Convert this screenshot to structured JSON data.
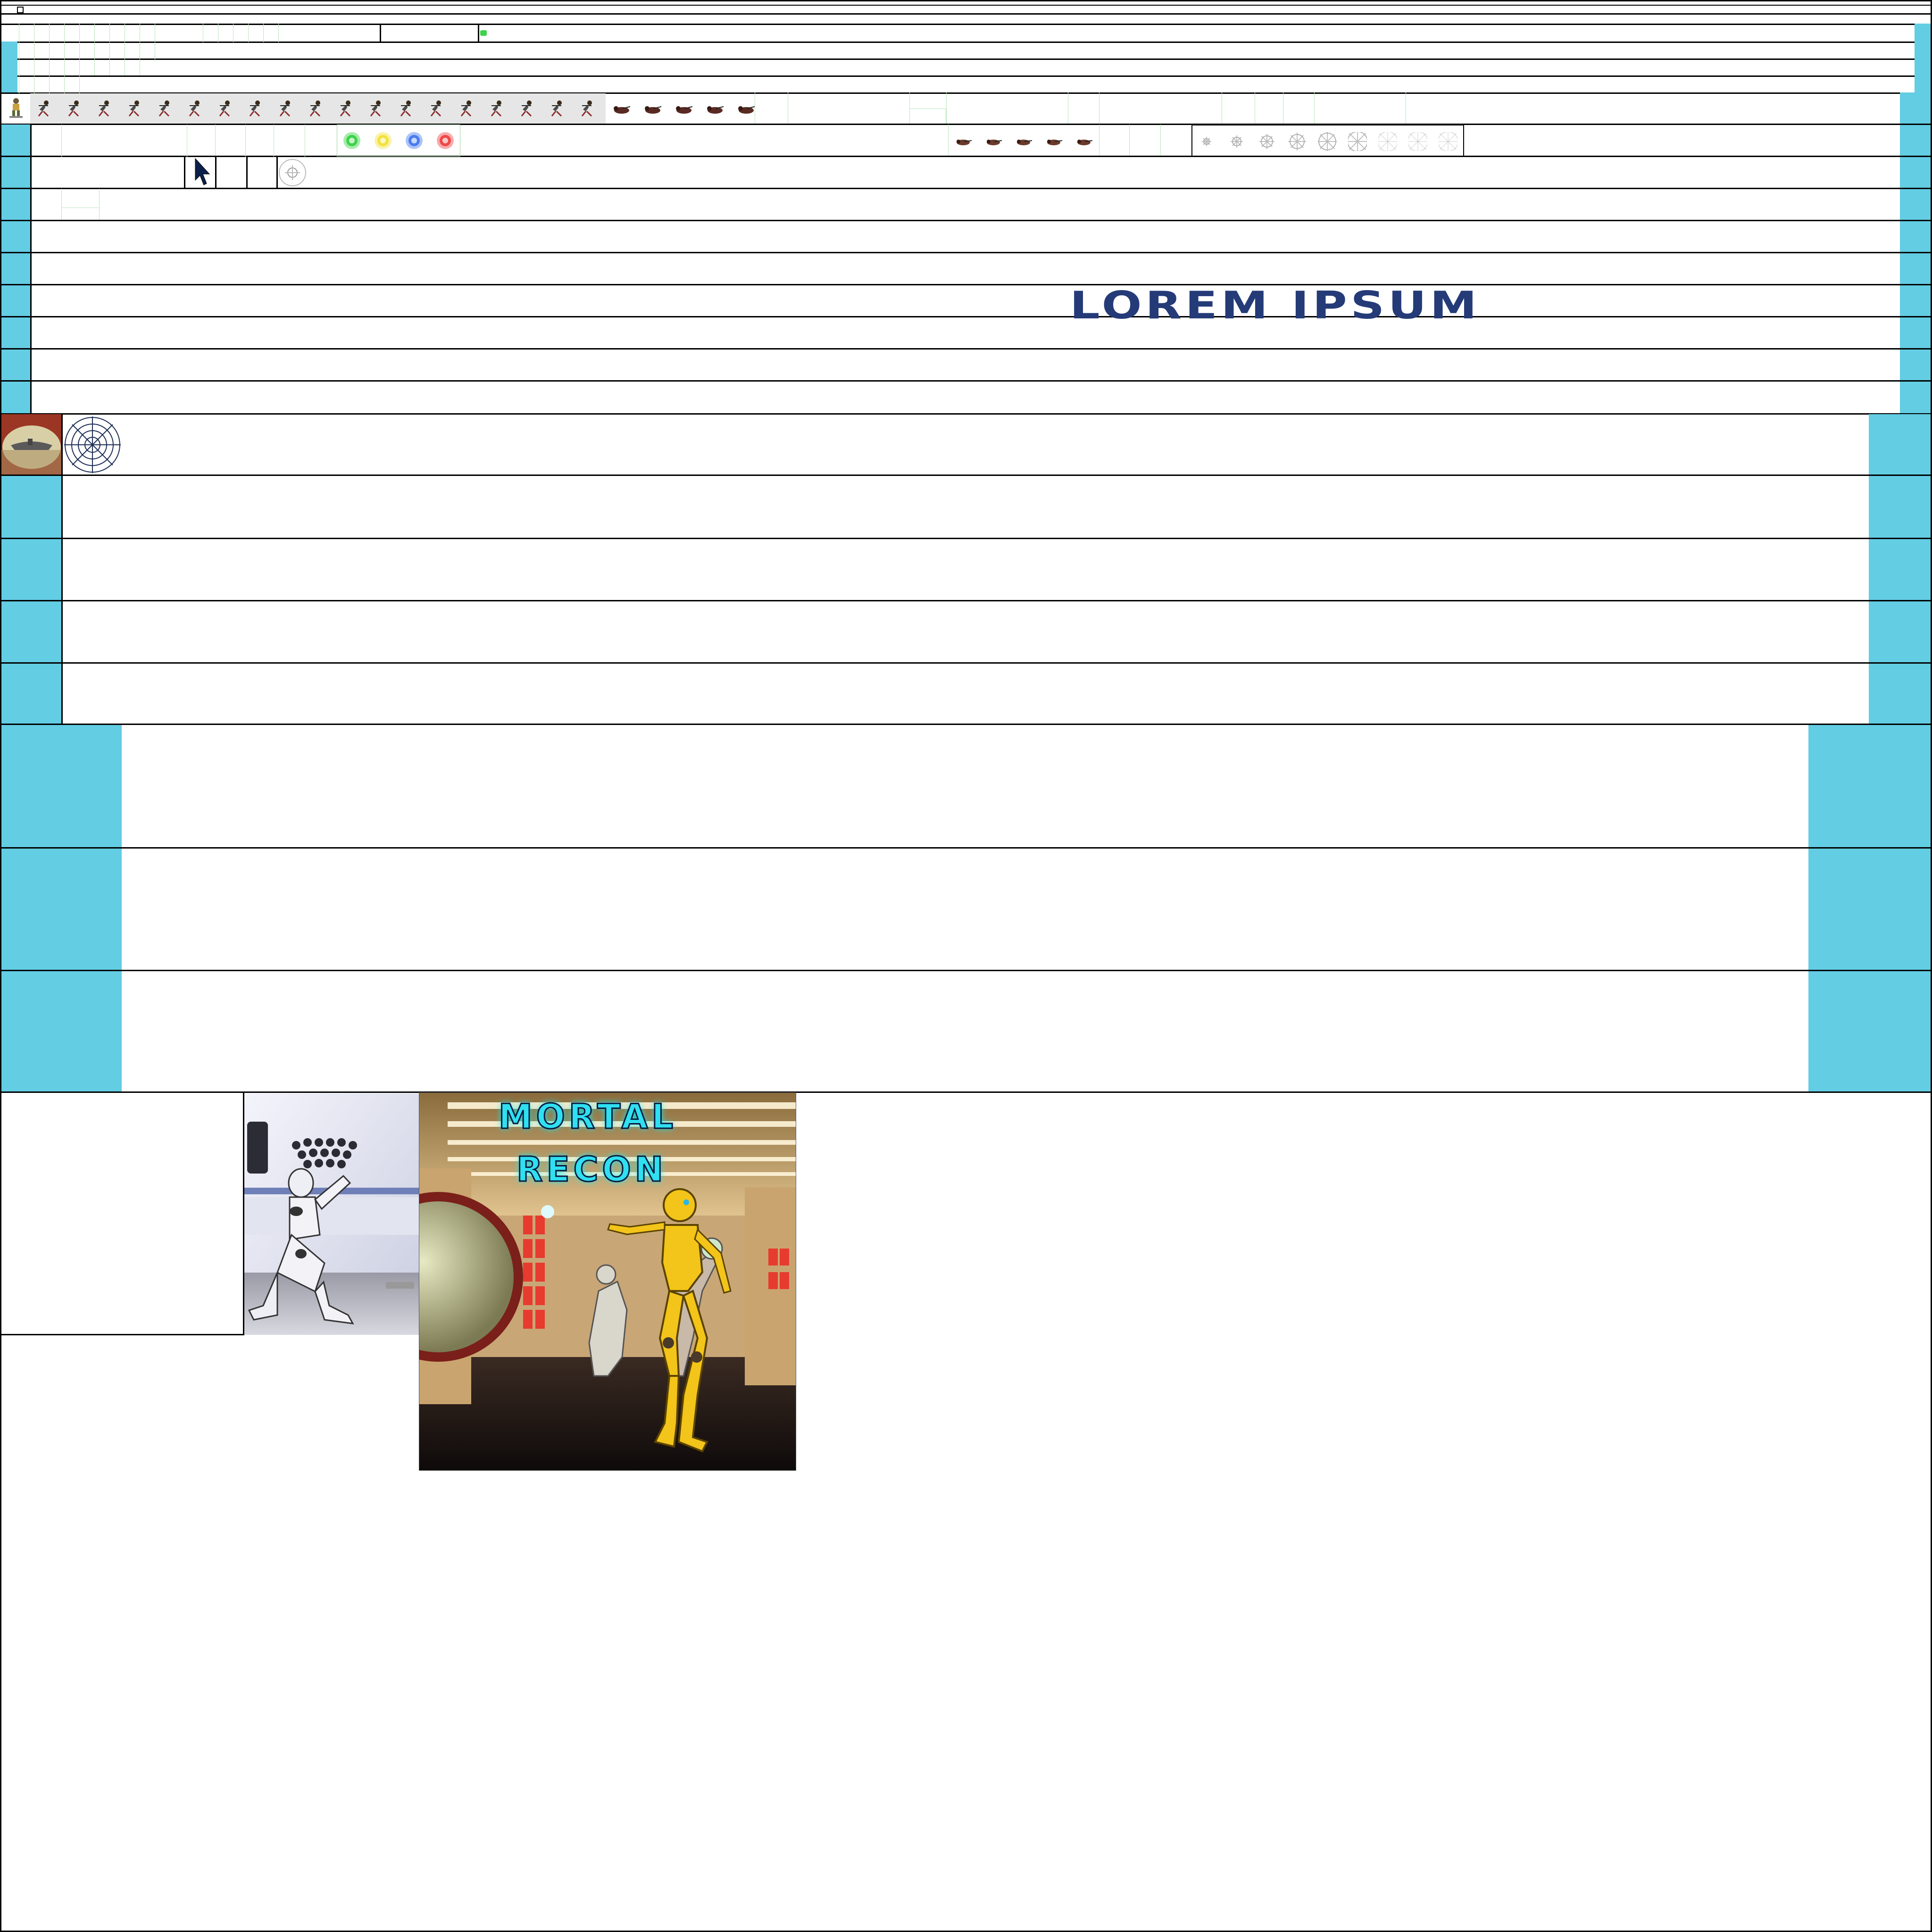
{
  "sheet": {
    "title_text": "LOREM IPSUM",
    "cover_title_line1": "MORTAL",
    "cover_title_line2": "RECON",
    "accent_color": "#62cde3",
    "logo_color": "#243b78",
    "grid_color": "#b9e6b9"
  },
  "sprites": {
    "player_icon": "soldier-icon",
    "running_frames": [
      "run-frame-icon",
      "run-frame-icon",
      "run-frame-icon",
      "run-frame-icon",
      "run-frame-icon",
      "run-frame-icon",
      "run-frame-icon",
      "run-frame-icon",
      "run-frame-icon",
      "run-frame-icon",
      "run-frame-icon",
      "run-frame-icon",
      "run-frame-icon",
      "run-frame-icon",
      "run-frame-icon",
      "run-frame-icon",
      "run-frame-icon",
      "run-frame-icon",
      "run-frame-icon"
    ],
    "crawl_frames": [
      "crawl-frame-icon",
      "crawl-frame-icon",
      "crawl-frame-icon",
      "crawl-frame-icon",
      "crawl-frame-icon"
    ],
    "orbs": [
      {
        "name": "green-orb-icon",
        "color": "#3fd24a"
      },
      {
        "name": "yellow-orb-icon",
        "color": "#f2e23b"
      },
      {
        "name": "blue-orb-icon",
        "color": "#4a7cf0"
      },
      {
        "name": "red-orb-icon",
        "color": "#f04848"
      }
    ],
    "crawl_frames_2": [
      "crawl-frame-icon",
      "crawl-frame-icon",
      "crawl-frame-icon",
      "crawl-frame-icon",
      "crawl-frame-icon"
    ],
    "explosion_frames": [
      "explosion-frame-icon",
      "explosion-frame-icon",
      "explosion-frame-icon",
      "explosion-frame-icon",
      "explosion-frame-icon",
      "explosion-frame-icon",
      "explosion-frame-icon",
      "explosion-frame-icon",
      "explosion-frame-icon"
    ],
    "cursor_icon": "cursor-icon",
    "target_icon": "crosshair-icon",
    "ship_badge_icon": "ship-badge-icon",
    "radar_icon": "radar-web-icon"
  }
}
